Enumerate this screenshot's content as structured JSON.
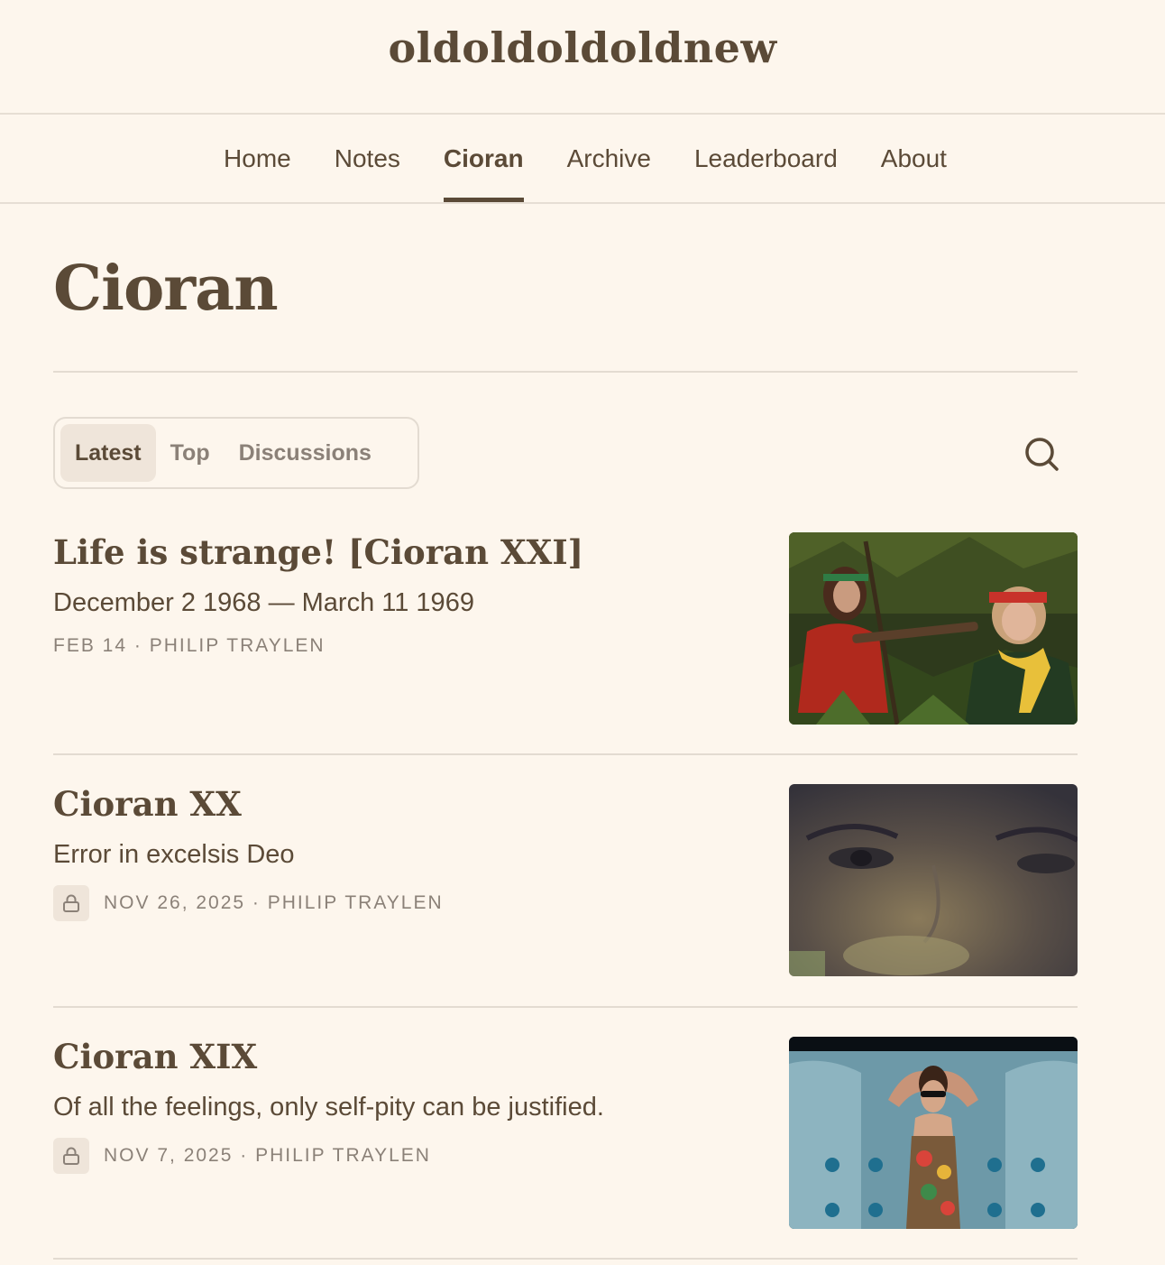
{
  "site": {
    "title": "oldoldoldoldnew"
  },
  "nav": {
    "items": [
      {
        "label": "Home"
      },
      {
        "label": "Notes"
      },
      {
        "label": "Cioran",
        "active": true
      },
      {
        "label": "Archive"
      },
      {
        "label": "Leaderboard"
      },
      {
        "label": "About"
      }
    ]
  },
  "page": {
    "title": "Cioran"
  },
  "tabs": {
    "items": [
      {
        "label": "Latest",
        "active": true
      },
      {
        "label": "Top"
      },
      {
        "label": "Discussions"
      }
    ],
    "search_icon": "search-icon"
  },
  "posts": [
    {
      "title": "Life is strange! [Cioran XXI]",
      "subtitle": "December 2 1968 — March 11 1969",
      "meta": "FEB 14 · PHILIP TRAYLEN",
      "locked": false,
      "thumbnail_icon": "forest-film-still"
    },
    {
      "title": "Cioran XX",
      "subtitle": "Error in excelsis Deo",
      "meta": "NOV 26, 2025 · PHILIP TRAYLEN",
      "locked": true,
      "thumbnail_icon": "face-close-up-still"
    },
    {
      "title": "Cioran XIX",
      "subtitle": "Of all the feelings, only self-pity can be justified.",
      "meta": "NOV 7, 2025 · PHILIP TRAYLEN",
      "locked": true,
      "thumbnail_icon": "pool-float-still"
    }
  ],
  "colors": {
    "background": "#fdf6ed",
    "text": "#5b4a37",
    "muted": "#8b8178",
    "divider": "#e3dbd1"
  }
}
